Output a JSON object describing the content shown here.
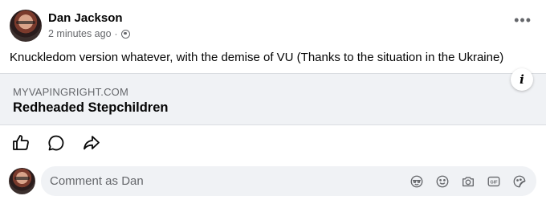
{
  "post": {
    "author": "Dan Jackson",
    "timestamp": "2 minutes ago",
    "separator": "·",
    "privacy_icon": "globe-icon",
    "more_label": "•••",
    "text": "Knuckledom version whatever, with the demise of VU (Thanks to the situation in the Ukraine)"
  },
  "link_preview": {
    "domain": "MYVAPINGRIGHT.COM",
    "title": "Redheaded Stepchildren",
    "info_label": "i"
  },
  "actions": [
    "like-icon",
    "comment-icon",
    "share-icon"
  ],
  "comment": {
    "placeholder": "Comment as Dan",
    "icons": [
      "avatar-sticker-icon",
      "emoji-icon",
      "camera-icon",
      "gif-icon",
      "sticker-icon"
    ],
    "gif_label": "GIF"
  },
  "colors": {
    "text_primary": "#050505",
    "text_secondary": "#65676b",
    "card_bg": "#f0f2f5",
    "divider": "#dadde1"
  }
}
